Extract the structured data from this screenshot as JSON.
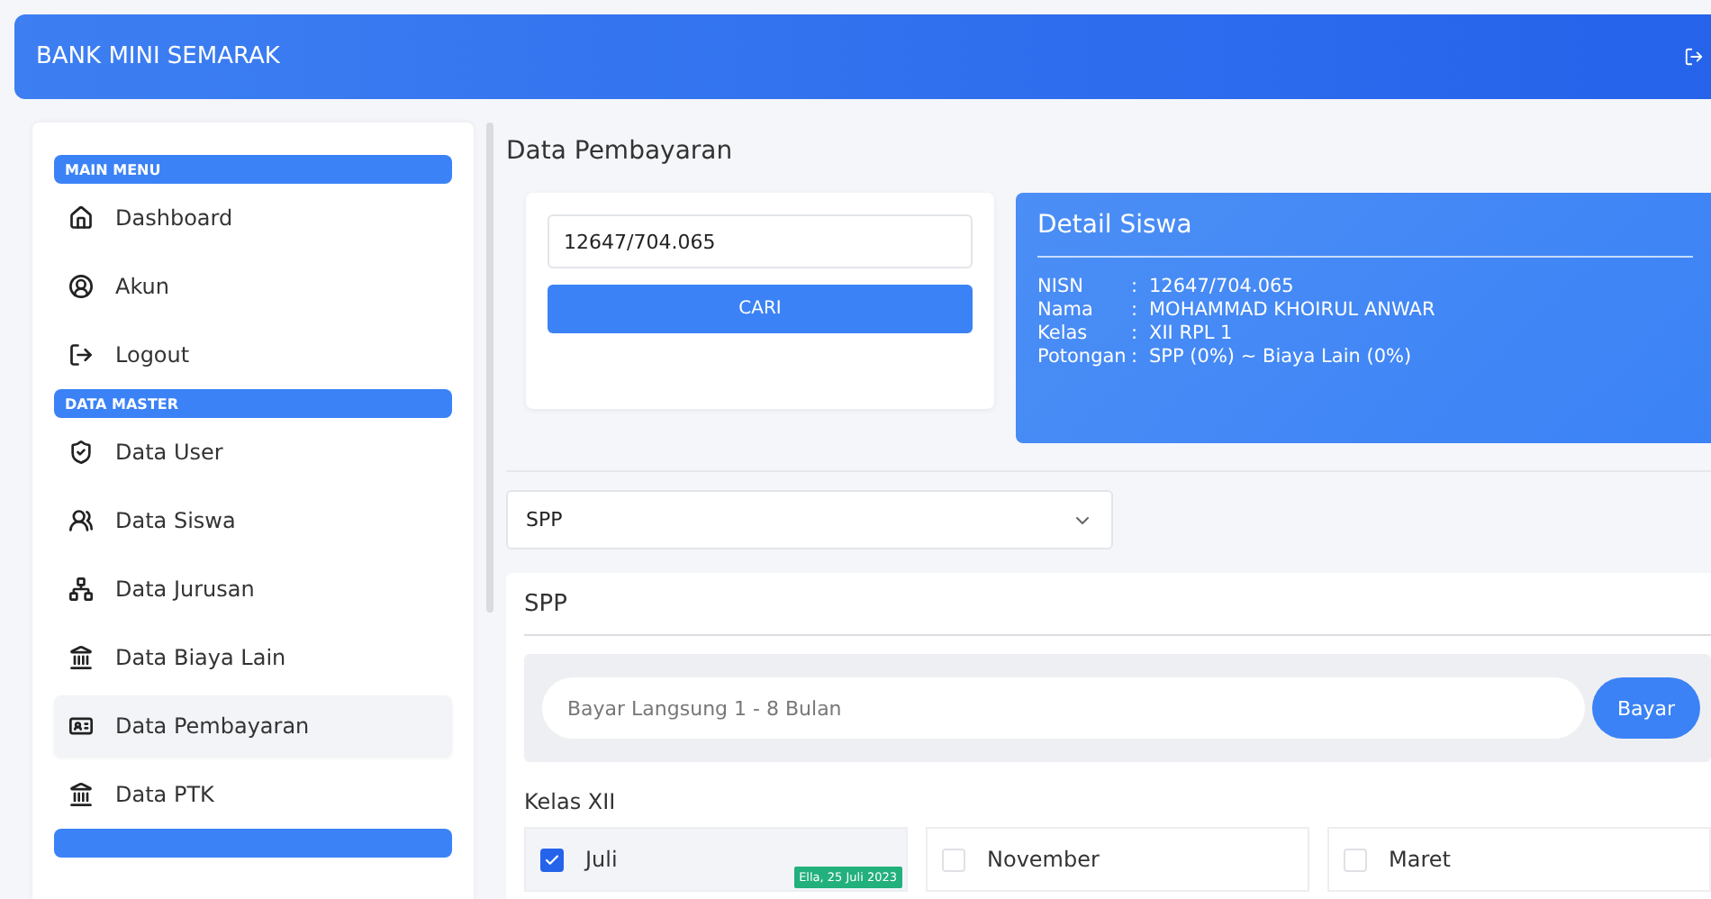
{
  "header": {
    "title": "BANK MINI SEMARAK"
  },
  "sidebar": {
    "sections": [
      {
        "title": "MAIN MENU",
        "items": [
          {
            "label": "Dashboard",
            "selected": false
          },
          {
            "label": "Akun",
            "selected": false
          },
          {
            "label": "Logout",
            "selected": false
          }
        ]
      },
      {
        "title": "DATA MASTER",
        "items": [
          {
            "label": "Data User",
            "selected": false
          },
          {
            "label": "Data Siswa",
            "selected": false
          },
          {
            "label": "Data Jurusan",
            "selected": false
          },
          {
            "label": "Data Biaya Lain",
            "selected": false
          },
          {
            "label": "Data Pembayaran",
            "selected": true
          },
          {
            "label": "Data PTK",
            "selected": false
          }
        ]
      }
    ]
  },
  "page_title": "Data Pembayaran",
  "search": {
    "value": "12647/704.065",
    "button": "CARI"
  },
  "detail": {
    "title": "Detail Siswa",
    "rows": [
      {
        "label": "NISN",
        "separator": ":",
        "value": "12647/704.065"
      },
      {
        "label": "Nama",
        "separator": ":",
        "value": "MOHAMMAD KHOIRUL ANWAR"
      },
      {
        "label": "Kelas",
        "separator": ":",
        "value": "XII RPL 1"
      },
      {
        "label": "Potongan",
        "separator": ":",
        "value": "SPP (0%) ~ Biaya Lain (0%)"
      }
    ]
  },
  "payment_type": {
    "value": "SPP"
  },
  "panel": {
    "title": "SPP",
    "pay_placeholder": "Bayar Langsung 1 - 8 Bulan",
    "pay_button": "Bayar",
    "group": "Kelas XII",
    "months": [
      {
        "label": "Juli",
        "checked": true,
        "badge": "Ella, 25 Juli 2023"
      },
      {
        "label": "November",
        "checked": false
      },
      {
        "label": "Maret",
        "checked": false
      }
    ]
  }
}
